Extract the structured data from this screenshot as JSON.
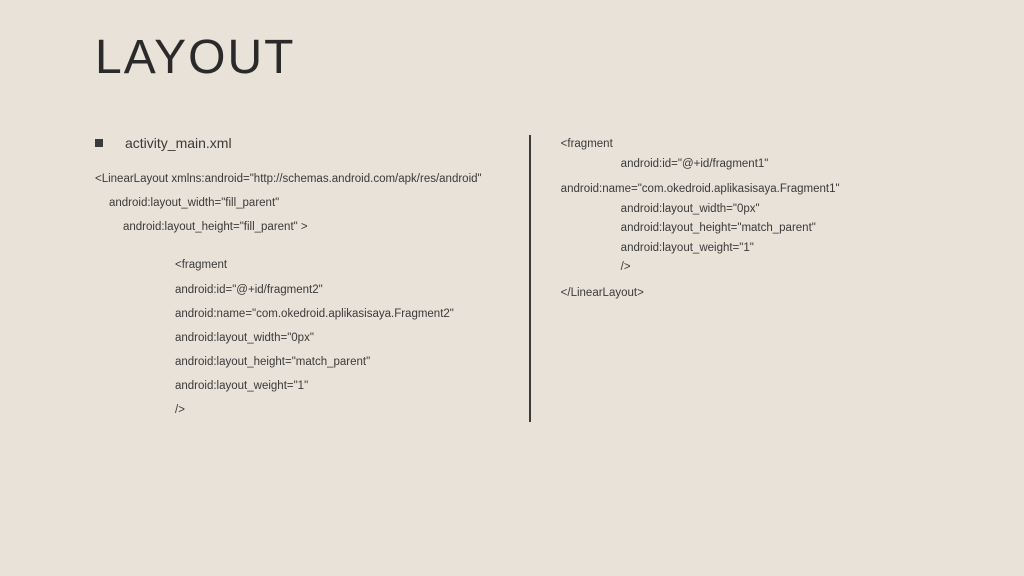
{
  "title": "LAYOUT",
  "bullet": "activity_main.xml",
  "left": {
    "l1": "<LinearLayout xmlns:android=\"http://schemas.android.com/apk/res/android\"",
    "l2": "android:layout_width=\"fill_parent\"",
    "l3": "android:layout_height=\"fill_parent\" >",
    "l4": "<fragment",
    "l5": "android:id=\"@+id/fragment2\"",
    "l6": "android:name=\"com.okedroid.aplikasisaya.Fragment2\"",
    "l7": "android:layout_width=\"0px\"",
    "l8": "android:layout_height=\"match_parent\"",
    "l9": "android:layout_weight=\"1\"",
    "l10": "/>"
  },
  "right": {
    "r1": "<fragment",
    "r2": "android:id=\"@+id/fragment1\"",
    "r3": "android:name=\"com.okedroid.aplikasisaya.Fragment1\"",
    "r4": "android:layout_width=\"0px\"",
    "r5": "android:layout_height=\"match_parent\"",
    "r6": "android:layout_weight=\"1\"",
    "r7": "/>",
    "r8": "</LinearLayout>"
  }
}
